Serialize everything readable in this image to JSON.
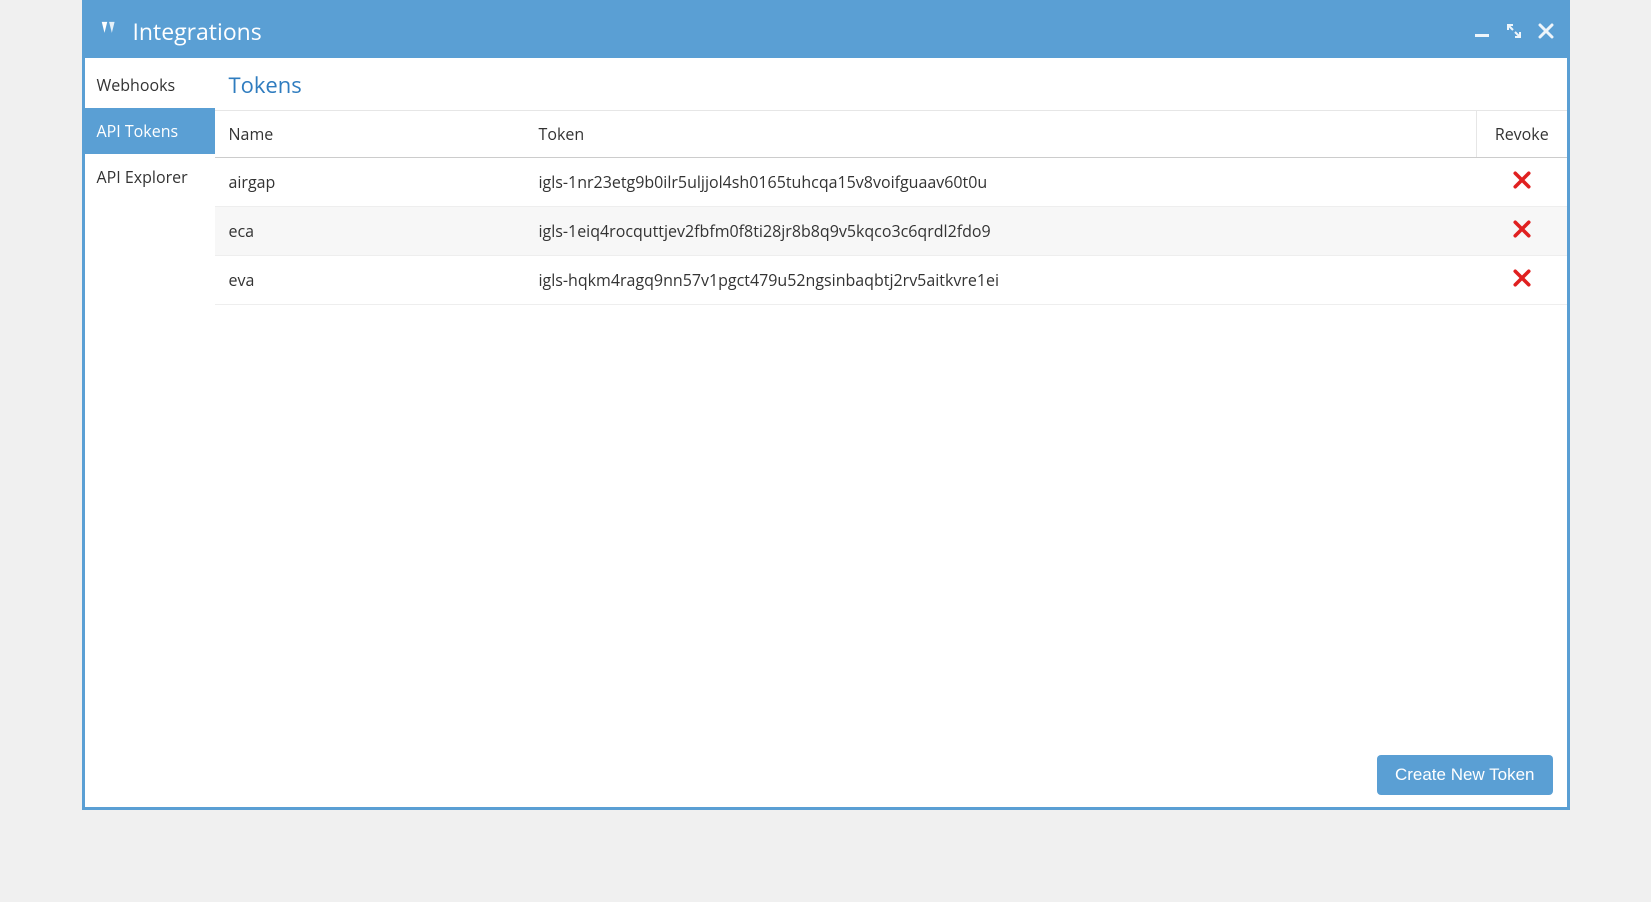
{
  "window": {
    "title": "Integrations"
  },
  "sidebar": {
    "items": [
      {
        "label": "Webhooks",
        "active": false
      },
      {
        "label": "API Tokens",
        "active": true
      },
      {
        "label": "API Explorer",
        "active": false
      }
    ]
  },
  "main": {
    "section_title": "Tokens",
    "columns": {
      "name": "Name",
      "token": "Token",
      "revoke": "Revoke"
    },
    "rows": [
      {
        "name": "airgap",
        "token": "igls-1nr23etg9b0ilr5uljjol4sh0165tuhcqa15v8voifguaav60t0u"
      },
      {
        "name": "eca",
        "token": "igls-1eiq4rocquttjev2fbfm0f8ti28jr8b8q9v5kqco3c6qrdl2fdo9"
      },
      {
        "name": "eva",
        "token": "igls-hqkm4ragq9nn57v1pgct479u52ngsinbaqbtj2rv5aitkvre1ei"
      }
    ],
    "create_button": "Create New Token"
  }
}
